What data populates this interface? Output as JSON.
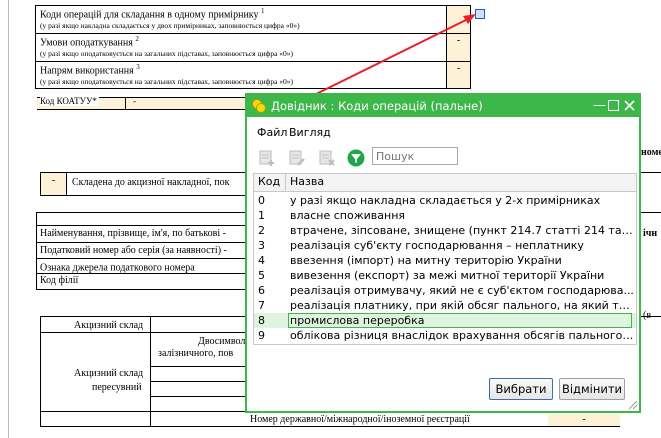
{
  "doc": {
    "rows_top": [
      {
        "label": "Коди операцій для складання в одному примірнику",
        "sup": "1",
        "note": "(у разі якщо накладна складається у двох примірниках, заповнюється цифра «0»)"
      },
      {
        "label": "Умови оподаткування",
        "sup": "2",
        "note": "(у разі якщо оподатковується на загальних підставах, заповнюється цифра «0»)",
        "value": "-"
      },
      {
        "label": "Напрям використання",
        "sup": "3",
        "note": "(у разі якщо оподатковується на загальних підставах, заповнюється цифра «0»)",
        "value": "-"
      }
    ],
    "koatuu_label": "Код КОАТУУ*",
    "koatuu_value": "-",
    "dash": "-",
    "composed_label": "Складена до акцизної накладної, пок",
    "fio_label": "Найменування, прізвище, ім'я, по батькові -",
    "tax_label": "Податковий номер або серія (за наявності) -",
    "source_label": "Ознака джерела податкового номера",
    "source_sup": "4",
    "branch_label": "Код філії",
    "excise_warehouse": "Акцизний склад",
    "double_mode": "Двосимвольн",
    "double_mode2": "залізничного, пов",
    "mobile_warehouse": "Акцизний склад",
    "mobile_warehouse2": "пересувний",
    "reg_number": "Номер державної/міжнародної/іноземної реєстрації",
    "right_frag1": "номе",
    "right_frag2": "ічн",
    "right_frag3": "(в"
  },
  "dialog": {
    "title": "Довідник : Коди операцій (пальне)",
    "menu": [
      "Файл",
      "Вигляд"
    ],
    "search_placeholder": "Пошук",
    "columns": {
      "code": "Код",
      "name": "Назва"
    },
    "rows": [
      {
        "code": "0",
        "name": "у разі якщо накладна складається у 2-х примірниках"
      },
      {
        "code": "1",
        "name": "власне споживання"
      },
      {
        "code": "2",
        "name": "втрачене, зіпсоване, знищене (пункт 214.7 статті 214 та ..."
      },
      {
        "code": "3",
        "name": "реалізація суб'єкту господарювання – неплатнику"
      },
      {
        "code": "4",
        "name": "ввезення (імпорт) на митну територію України"
      },
      {
        "code": "5",
        "name": "вивезення (експорт) за межі митної території України"
      },
      {
        "code": "6",
        "name": "реалізація отримувачу, який не є суб'єктом господарюва..."
      },
      {
        "code": "7",
        "name": "реалізація платнику, при якій обсяг пального, на який так..."
      },
      {
        "code": "8",
        "name": "промислова переробка"
      },
      {
        "code": "9",
        "name": "облікова різниця внаслідок врахування обсягів пального, ..."
      }
    ],
    "selected_code": "8",
    "ok_label": "Вибрати",
    "cancel_label": "Відмінити"
  },
  "colors": {
    "accent": "#3db64a",
    "arrow": "#e8202a",
    "cell": "#fdf1d8"
  }
}
